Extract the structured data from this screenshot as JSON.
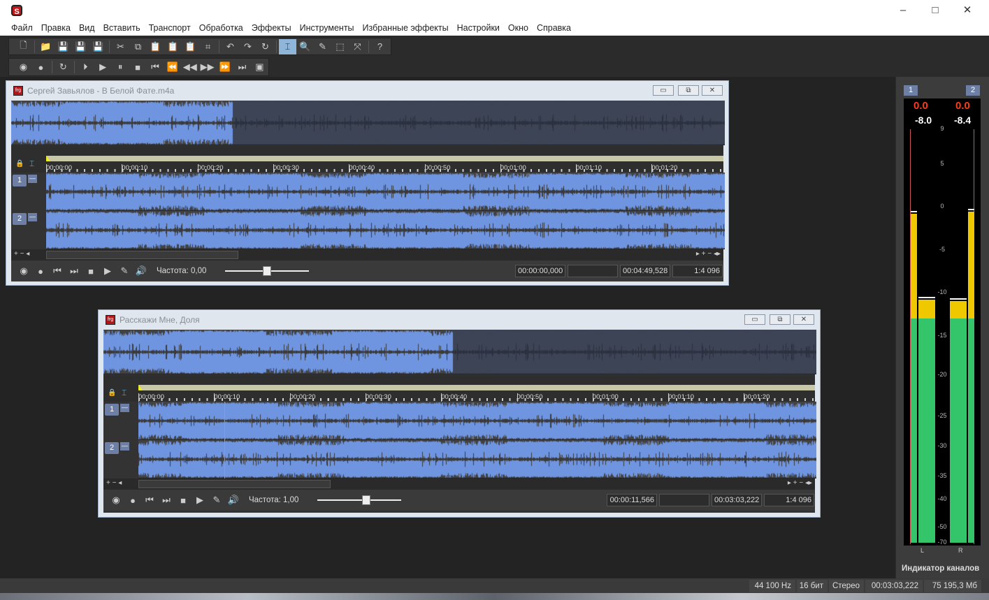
{
  "app": {
    "window_controls": [
      "minimize",
      "maximize",
      "close"
    ]
  },
  "menu": [
    "Файл",
    "Правка",
    "Вид",
    "Вставить",
    "Транспорт",
    "Обработка",
    "Эффекты",
    "Инструменты",
    "Избранные эффекты",
    "Настройки",
    "Окно",
    "Справка"
  ],
  "toolbar1": [
    {
      "icon": "new-file",
      "g": "🗋"
    },
    {
      "sep": 1
    },
    {
      "icon": "open-folder",
      "g": "📁"
    },
    {
      "icon": "save",
      "g": "💾"
    },
    {
      "icon": "save-as",
      "g": "💾"
    },
    {
      "icon": "save-all",
      "g": "💾"
    },
    {
      "sep": 1
    },
    {
      "icon": "cut",
      "g": "✂"
    },
    {
      "icon": "copy",
      "g": "⧉"
    },
    {
      "icon": "paste",
      "g": "📋"
    },
    {
      "icon": "paste-special",
      "g": "📋"
    },
    {
      "icon": "mix",
      "g": "📋"
    },
    {
      "icon": "crop",
      "g": "⌗"
    },
    {
      "sep": 1
    },
    {
      "icon": "undo",
      "g": "↶"
    },
    {
      "icon": "redo",
      "g": "↷"
    },
    {
      "icon": "repeat",
      "g": "↻"
    },
    {
      "sep": 1
    },
    {
      "icon": "edit-tool",
      "g": "⌶",
      "on": true
    },
    {
      "icon": "magnify-tool",
      "g": "🔍"
    },
    {
      "icon": "pencil-tool",
      "g": "✎"
    },
    {
      "icon": "event-tool",
      "g": "⬚"
    },
    {
      "icon": "envelope-tool",
      "g": "⤧"
    },
    {
      "sep": 1
    },
    {
      "icon": "help",
      "g": "?"
    }
  ],
  "toolbar2": [
    {
      "icon": "record",
      "g": "◉"
    },
    {
      "icon": "record-circle",
      "g": "●"
    },
    {
      "sep": 1
    },
    {
      "icon": "loop",
      "g": "↻"
    },
    {
      "sep": 1
    },
    {
      "icon": "play-all",
      "g": "⏵"
    },
    {
      "icon": "play",
      "g": "▶"
    },
    {
      "icon": "pause",
      "g": "⏸"
    },
    {
      "icon": "stop",
      "g": "■"
    },
    {
      "icon": "go-start",
      "g": "⏮"
    },
    {
      "icon": "rewind",
      "g": "⏪"
    },
    {
      "icon": "rewind-step",
      "g": "◀◀"
    },
    {
      "icon": "forward-step",
      "g": "▶▶"
    },
    {
      "icon": "fast-forward",
      "g": "⏩"
    },
    {
      "icon": "go-end",
      "g": "⏭"
    },
    {
      "icon": "record-mode",
      "g": "▣"
    }
  ],
  "windows": [
    {
      "title": "Сергей Завьялов - В Белой Фате.m4a",
      "rate_label": "Частота: 0,00",
      "cursor": "00:00:00,000",
      "selection": "",
      "length": "00:04:49,528",
      "zoom": "1:4 096",
      "ruler": [
        "00:00:00",
        "00:00:10",
        "00:00:20",
        "00:00:30",
        "00:00:40",
        "00:00:50",
        "00:01:00",
        "00:01:10",
        "00:01:20"
      ],
      "channels": [
        "1",
        "2"
      ],
      "overview_selected_fraction": 0.31,
      "slider_position": 0.5
    },
    {
      "title": "Расскажи Мне, Доля",
      "rate_label": "Частота: 1,00",
      "cursor": "00:00:11,566",
      "selection": "",
      "length": "00:03:03,222",
      "zoom": "1:4 096",
      "ruler": [
        "00:00:00",
        "00:00:10",
        "00:00:20",
        "00:00:30",
        "00:00:40",
        "00:00:50",
        "00:01:00",
        "00:01:10",
        "00:01:20"
      ],
      "channels": [
        "1",
        "2"
      ],
      "overview_selected_fraction": 0.49,
      "slider_position": 0.58
    }
  ],
  "meter": {
    "title": "Индикатор каналов",
    "channels": [
      "1",
      "2"
    ],
    "peak_hold": [
      "0.0",
      "0.0"
    ],
    "level": [
      "-8.0",
      "-8.4"
    ],
    "scale": [
      "9",
      "5",
      "0",
      "-5",
      "-10",
      "-15",
      "-20",
      "-25",
      "-30",
      "-35",
      "-40",
      "-50",
      "-70"
    ],
    "lr": [
      "L",
      "R"
    ],
    "outer_level_db": [
      -0.8,
      -0.6
    ],
    "inner_level_db": [
      -10.8,
      -11.0
    ],
    "colors": {
      "green": "#34c46a",
      "yellow": "#f0c800",
      "peak": "#ff3a1a"
    }
  },
  "status": {
    "rate": "44 100 Hz",
    "bits": "16 бит",
    "mode": "Стерео",
    "length": "00:03:03,222",
    "free": "75 195,3 Мб"
  }
}
